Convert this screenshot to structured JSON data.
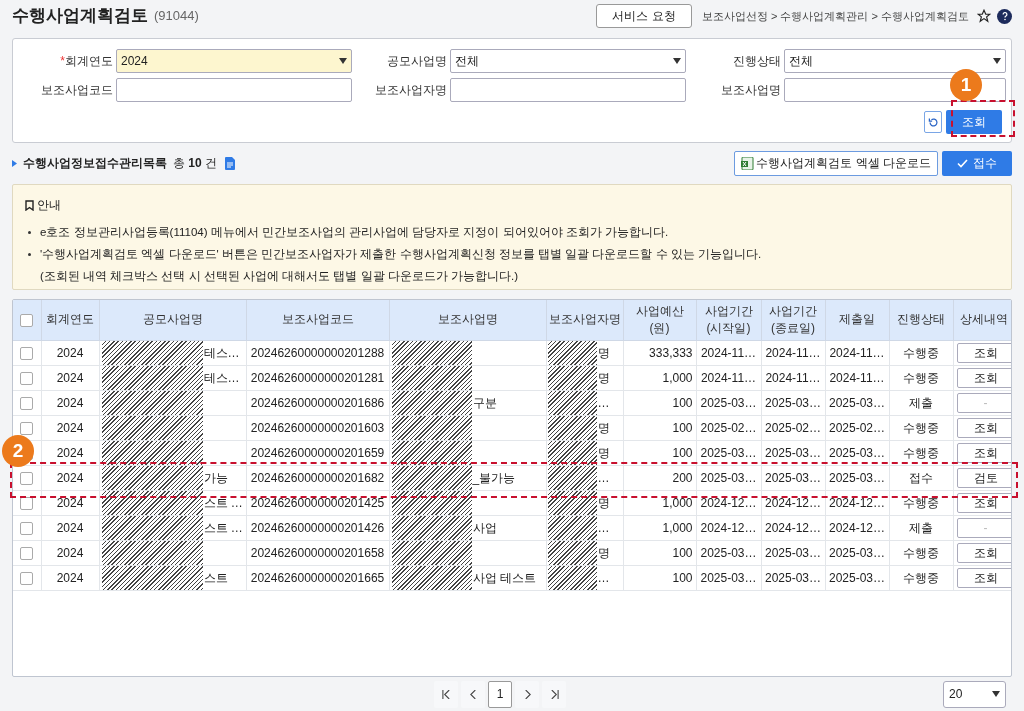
{
  "header": {
    "title": "수행사업계획검토",
    "code": "(91044)",
    "service_button": "서비스 요청",
    "breadcrumb": "보조사업선정 > 수행사업계획관리 > 수행사업계획검토"
  },
  "search": {
    "fields": [
      {
        "label": "회계연도",
        "required_mark": "*",
        "kind": "select",
        "value": "2024",
        "highlight": true
      },
      {
        "label": "공모사업명",
        "kind": "select",
        "value": "전체",
        "highlight": false
      },
      {
        "label": "진행상태",
        "kind": "select",
        "value": "전체",
        "highlight": false
      },
      {
        "label": "보조사업코드",
        "kind": "input",
        "highlight": false
      },
      {
        "label": "보조사업자명",
        "kind": "input",
        "highlight": false
      },
      {
        "label": "보조사업명",
        "kind": "input",
        "highlight": false
      }
    ],
    "search_button": "조회"
  },
  "list": {
    "title": "수행사업정보접수관리목록",
    "total": "총 **10** 건",
    "excel_button": "수행사업계획검토 엑셀 다운로드",
    "receive_button": "접수"
  },
  "notice": {
    "title": "안내",
    "lines": [
      {
        "kind": "bullet",
        "text": "e호조 정보관리사업등록(11104) 메뉴에서 민간보조사업의 관리사업에 담당자로 지정이 되어있어야 조회가 가능합니다."
      },
      {
        "kind": "bullet",
        "text": "'수행사업계획검토 엑셀 다운로드' 버튼은 민간보조사업자가 제출한 수행사업계획신청 정보를 탭별 일괄 다운로드할 수 있는 기능입니다."
      },
      {
        "kind": "note",
        "text": "(조회된 내역 체크박스 선택 시 선택된 사업에 대해서도 탭별 일괄 다운로드가 가능합니다.)"
      }
    ]
  },
  "table": {
    "select_all_checked": false,
    "columns": [
      "회계연도",
      "공모사업명",
      "보조사업코드",
      "보조사업명",
      "보조사업자명",
      "사업예산\n(원)",
      "사업기간\n(시작일)",
      "사업기간\n(종료일)",
      "제출일",
      "진행상태",
      "상세내역"
    ],
    "rows": [
      {
        "checked": false,
        "year": "2024",
        "project": "테스…",
        "code": "20246260000000201288",
        "operator": "명",
        "budget": "333,333",
        "start": "2024-11…",
        "end": "2024-11…",
        "submitted": "2024-11…",
        "status": "수행중",
        "detail": "조회",
        "detail_disabled": false
      },
      {
        "checked": false,
        "year": "2024",
        "project": "테스…",
        "code": "20246260000000201281",
        "operator": "명",
        "budget": "1,000",
        "start": "2024-11…",
        "end": "2024-11…",
        "submitted": "2024-11…",
        "status": "수행중",
        "detail": "조회",
        "detail_disabled": false
      },
      {
        "checked": false,
        "year": "2024",
        "code": "20246260000000201686",
        "name": "구분",
        "operator": "…",
        "budget": "100",
        "start": "2025-03…",
        "end": "2025-03…",
        "submitted": "2025-03…",
        "status": "제출",
        "detail": "-",
        "detail_disabled": true
      },
      {
        "checked": false,
        "year": "2024",
        "code": "20246260000000201603",
        "operator": "명",
        "budget": "100",
        "start": "2025-02…",
        "end": "2025-02…",
        "submitted": "2025-02…",
        "status": "수행중",
        "detail": "조회",
        "detail_disabled": false
      },
      {
        "checked": false,
        "year": "2024",
        "code": "20246260000000201659",
        "operator": "명",
        "budget": "100",
        "start": "2025-03…",
        "end": "2025-03…",
        "submitted": "2025-03…",
        "status": "수행중",
        "detail": "조회",
        "detail_disabled": false
      },
      {
        "checked": false,
        "year": "2024",
        "project": "가능",
        "code": "20246260000000201682",
        "name": "_불가능",
        "operator": "…",
        "budget": "200",
        "start": "2025-03…",
        "end": "2025-03…",
        "submitted": "2025-03…",
        "status": "접수",
        "detail": "검토",
        "detail_disabled": false
      },
      {
        "checked": false,
        "year": "2024",
        "project": "스트 …",
        "code": "20246260000000201425",
        "operator": "명",
        "budget": "1,000",
        "start": "2024-12…",
        "end": "2024-12…",
        "submitted": "2024-12…",
        "status": "수행중",
        "detail": "조회",
        "detail_disabled": false
      },
      {
        "checked": false,
        "year": "2024",
        "project": "스트 …",
        "code": "20246260000000201426",
        "name": "사업",
        "operator": "…",
        "budget": "1,000",
        "start": "2024-12…",
        "end": "2024-12…",
        "submitted": "2024-12…",
        "status": "제출",
        "detail": "-",
        "detail_disabled": true
      },
      {
        "checked": false,
        "year": "2024",
        "code": "20246260000000201658",
        "operator": "명",
        "budget": "100",
        "start": "2025-03…",
        "end": "2025-03…",
        "submitted": "2025-03…",
        "status": "수행중",
        "detail": "조회",
        "detail_disabled": false
      },
      {
        "checked": false,
        "year": "2024",
        "project": "스트",
        "code": "20246260000000201665",
        "name": "사업 테스트",
        "operator": "…",
        "budget": "100",
        "start": "2025-03…",
        "end": "2025-03…",
        "submitted": "2025-03…",
        "status": "수행중",
        "detail": "조회",
        "detail_disabled": false
      }
    ]
  },
  "pagination": {
    "pages": [
      {
        "label": "1",
        "selected": true
      }
    ],
    "page_size": "20"
  },
  "annotations": [
    {
      "label": "1"
    },
    {
      "label": "2"
    }
  ]
}
